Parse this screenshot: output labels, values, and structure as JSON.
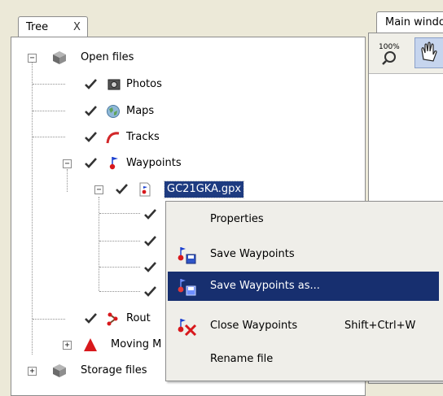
{
  "tree_panel": {
    "tab_label": "Tree",
    "close_label": "X",
    "items": [
      {
        "label": "Open files",
        "expander": "−",
        "icon": "cube-icon"
      },
      {
        "label": "Photos",
        "icon": "camera-icon",
        "checked": true
      },
      {
        "label": "Maps",
        "icon": "map-icon",
        "checked": true
      },
      {
        "label": "Tracks",
        "icon": "track-icon",
        "checked": true
      },
      {
        "label": "Waypoints",
        "expander": "−",
        "icon": "waypoint-flag-icon",
        "checked": true
      },
      {
        "label": "GC21GKA.gpx",
        "expander": "−",
        "icon": "gpx-file-icon",
        "checked": true,
        "selected": true
      },
      {
        "label": "Rout",
        "icon": "route-icon",
        "checked": true
      },
      {
        "label": "Moving M",
        "expander": "+",
        "icon": "moving-marker-icon"
      },
      {
        "label": "Storage files",
        "expander": "+",
        "icon": "storage-cube-icon"
      }
    ]
  },
  "main_panel": {
    "tab_label": "Main windo",
    "toolbar": [
      {
        "icon": "zoom-100-icon",
        "label": "100%"
      },
      {
        "icon": "pan-hand-icon"
      }
    ]
  },
  "context_menu": {
    "items": [
      {
        "label": "Properties",
        "icon": null
      },
      {
        "label": "Save Waypoints",
        "icon": "save-waypoints-icon"
      },
      {
        "label": "Save Waypoints as...",
        "icon": "save-waypoints-as-icon",
        "highlighted": true
      },
      {
        "label": "Close Waypoints",
        "icon": "close-waypoints-icon",
        "shortcut": "Shift+Ctrl+W"
      },
      {
        "label": "Rename file",
        "icon": null
      }
    ]
  },
  "colors": {
    "background": "#ece9d8",
    "selection": "#1e3b80",
    "menu_highlight": "#172f6f"
  }
}
